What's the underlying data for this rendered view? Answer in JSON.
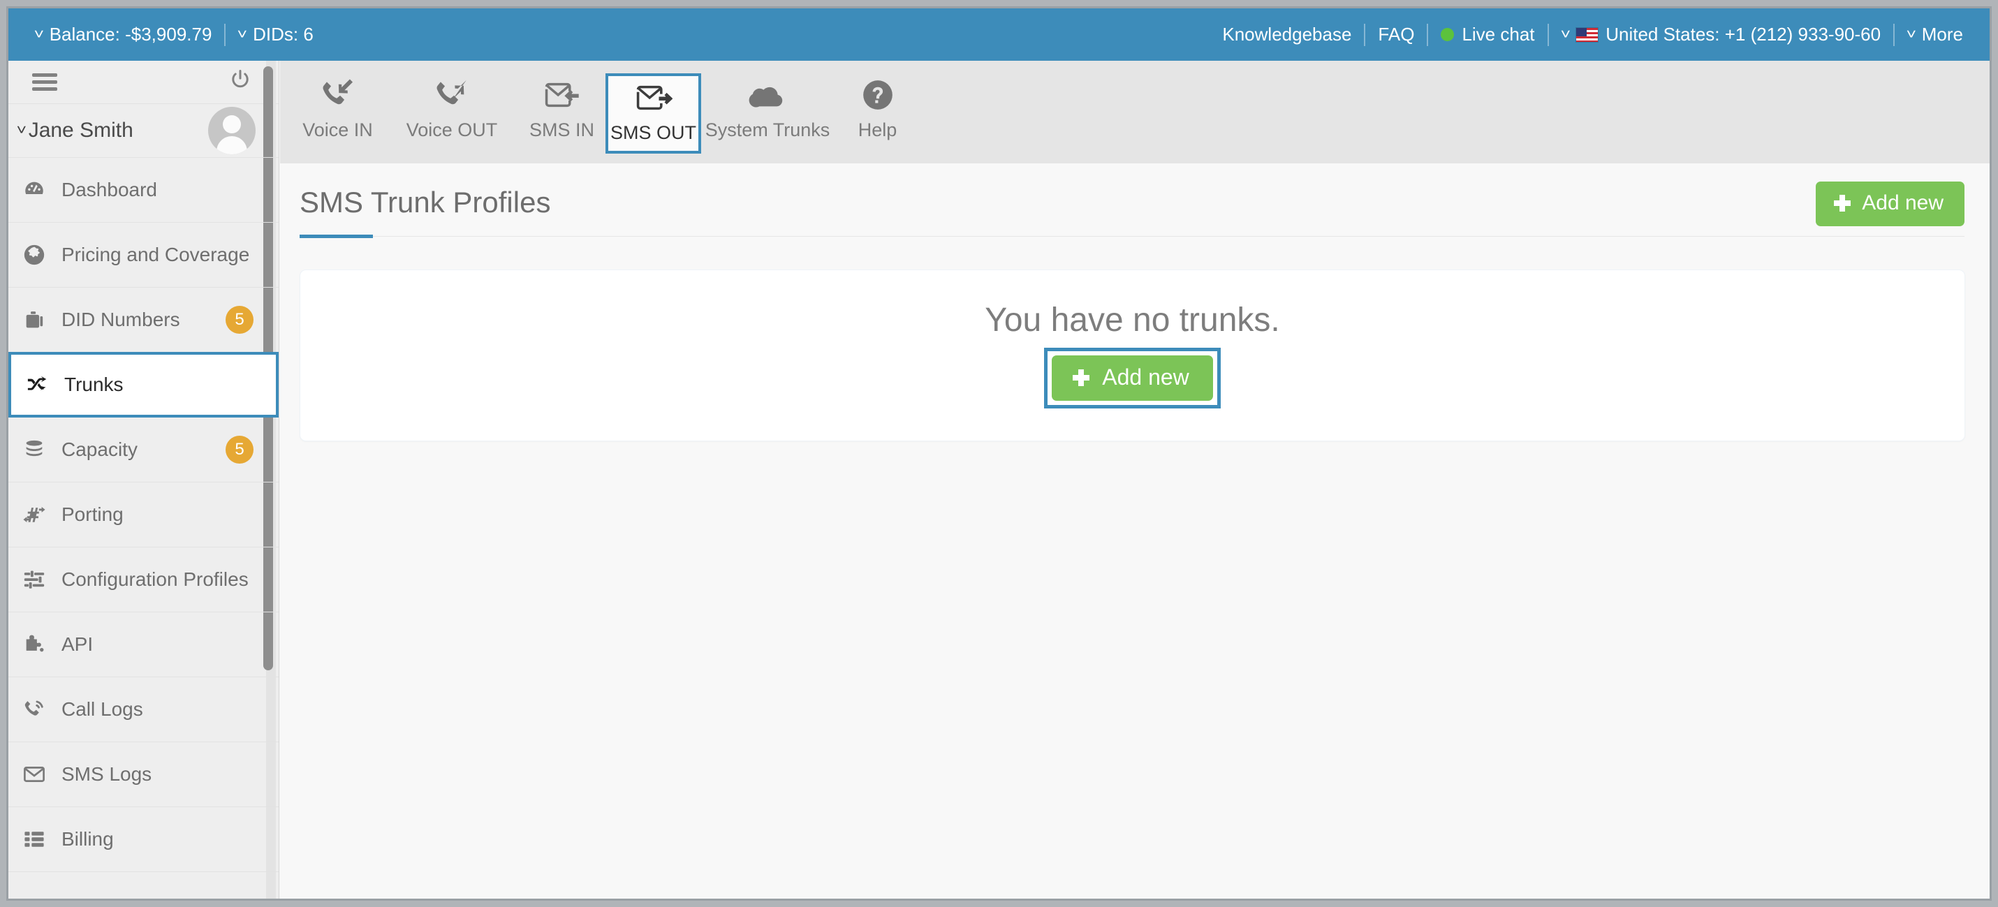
{
  "topbar": {
    "balance_label": "Balance: -$3,909.79",
    "dids_label": "DIDs: 6",
    "knowledgebase": "Knowledgebase",
    "faq": "FAQ",
    "live_chat": "Live chat",
    "country_phone": "United States: +1 (212) 933-90-60",
    "more": "More",
    "bg_color": "#3d8cba",
    "livechat_dot_color": "#5cc23c"
  },
  "sidebar": {
    "user_name": "Jane Smith",
    "hamburger_icon": "hamburger-menu-icon",
    "power_icon": "power-off-icon",
    "avatar_icon": "user-avatar-icon",
    "badge_color": "#e6a834",
    "items": [
      {
        "label": "Dashboard",
        "icon": "dashboard-gauge-icon",
        "badge": "",
        "active": false
      },
      {
        "label": "Pricing and Coverage",
        "icon": "globe-icon",
        "badge": "",
        "active": false
      },
      {
        "label": "DID Numbers",
        "icon": "briefcase-icon",
        "badge": "5",
        "active": false
      },
      {
        "label": "Trunks",
        "icon": "shuffle-arrows-icon",
        "badge": "",
        "active": true
      },
      {
        "label": "Capacity",
        "icon": "database-stack-icon",
        "badge": "5",
        "active": false
      },
      {
        "label": "Porting",
        "icon": "hash-arrows-icon",
        "badge": "",
        "active": false
      },
      {
        "label": "Configuration Profiles",
        "icon": "sliders-icon",
        "badge": "",
        "active": false
      },
      {
        "label": "API",
        "icon": "puzzle-piece-icon",
        "badge": "",
        "active": false
      },
      {
        "label": "Call Logs",
        "icon": "phone-handset-icon",
        "badge": "",
        "active": false
      },
      {
        "label": "SMS Logs",
        "icon": "envelope-icon",
        "badge": "",
        "active": false
      },
      {
        "label": "Billing",
        "icon": "list-grid-icon",
        "badge": "",
        "active": false
      }
    ]
  },
  "tabs": [
    {
      "label": "Voice IN",
      "icon": "phone-incoming-icon",
      "active": false
    },
    {
      "label": "Voice OUT",
      "icon": "phone-outgoing-icon",
      "active": false
    },
    {
      "label": "SMS IN",
      "icon": "envelope-incoming-icon",
      "active": false
    },
    {
      "label": "SMS OUT",
      "icon": "envelope-outgoing-icon",
      "active": true
    },
    {
      "label": "System Trunks",
      "icon": "cloud-icon",
      "active": false
    },
    {
      "label": "Help",
      "icon": "question-circle-icon",
      "active": false
    }
  ],
  "main": {
    "page_title": "SMS Trunk Profiles",
    "add_new_top_label": "Add new",
    "empty_message": "You have no trunks.",
    "add_new_center_label": "Add new",
    "accent_color": "#3d8cba",
    "button_color": "#7cc457"
  }
}
